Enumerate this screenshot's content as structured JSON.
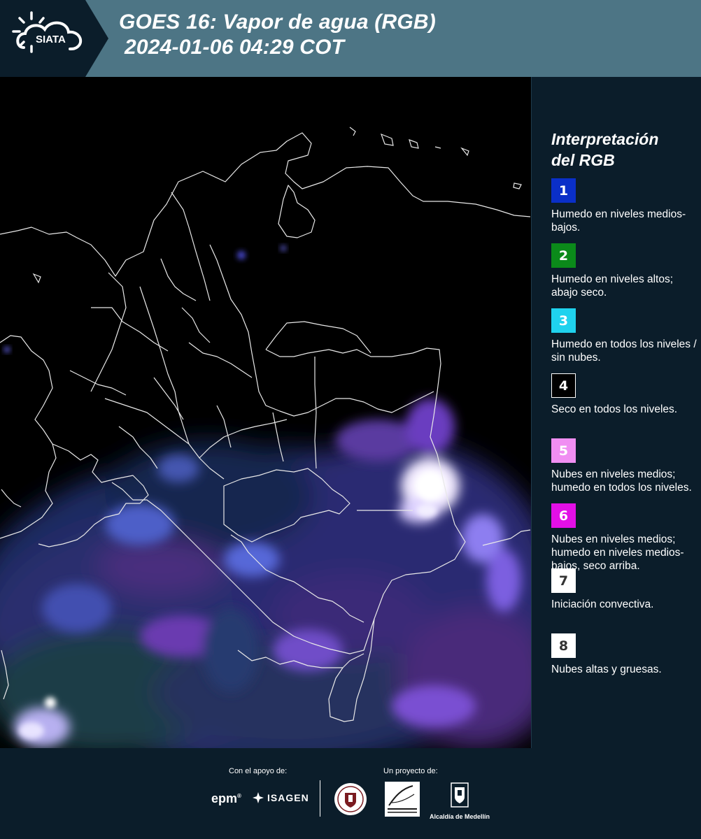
{
  "header": {
    "logo_text": "SIATA",
    "title_line1": "GOES 16: Vapor de agua (RGB)",
    "title_line2": "2024-01-06 04:29 COT"
  },
  "legend": {
    "title_line1": "Interpretación",
    "title_line2": "del RGB",
    "items": [
      {
        "number": "1",
        "color": "#0a2fc8",
        "text_color": "#ffffff",
        "description": "Humedo en niveles medios-bajos."
      },
      {
        "number": "2",
        "color": "#0b8a1a",
        "text_color": "#ffffff",
        "description": "Humedo en niveles altos; abajo seco."
      },
      {
        "number": "3",
        "color": "#1fd2ee",
        "text_color": "#ffffff",
        "description": "Humedo en todos los niveles / sin nubes."
      },
      {
        "number": "4",
        "color": "#000000",
        "text_color": "#ffffff",
        "description": "Seco en todos los niveles."
      },
      {
        "number": "5",
        "color": "#f08ef2",
        "text_color": "#ffffff",
        "description": "Nubes en niveles medios; humedo en todos los niveles."
      },
      {
        "number": "6",
        "color": "#e30fe6",
        "text_color": "#ffffff",
        "description": "Nubes en niveles medios; humedo en niveles medios-bajos, seco arriba."
      },
      {
        "number": "7",
        "color": "#ffffff",
        "text_color": "#333333",
        "description": "Iniciación convectiva."
      },
      {
        "number": "8",
        "color": "#ffffff",
        "text_color": "#333333",
        "description": "Nubes altas y gruesas."
      }
    ]
  },
  "footer": {
    "support_label": "Con el apoyo de:",
    "project_label": "Un proyecto de:",
    "epm_text": "epm",
    "isagen_text": "ISAGEN",
    "alcaldia_text": "Alcaldía de Medellín"
  }
}
